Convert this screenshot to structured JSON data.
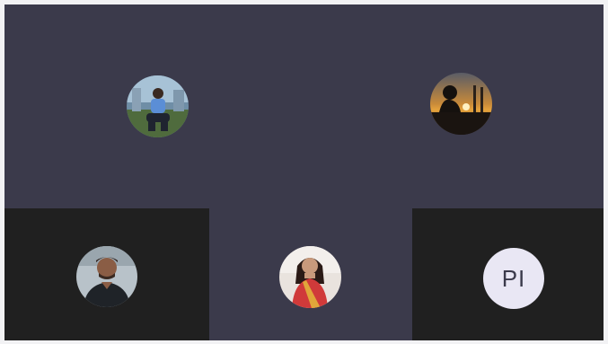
{
  "participants": [
    {
      "name": "",
      "avatar_icon": "avatar-photo-man-sitting"
    },
    {
      "name": "",
      "avatar_icon": "avatar-photo-sunset-silhouette"
    },
    {
      "name": "",
      "avatar_icon": "avatar-photo-man-dark-shirt"
    },
    {
      "name": "",
      "avatar_icon": "avatar-photo-woman-saree"
    },
    {
      "name": "",
      "initials": "PI"
    }
  ],
  "colors": {
    "tile_purple": "#3b3a4b",
    "tile_dark": "#202020",
    "initials_bg": "#e9e7f4",
    "initials_text": "#3b3a4b"
  }
}
